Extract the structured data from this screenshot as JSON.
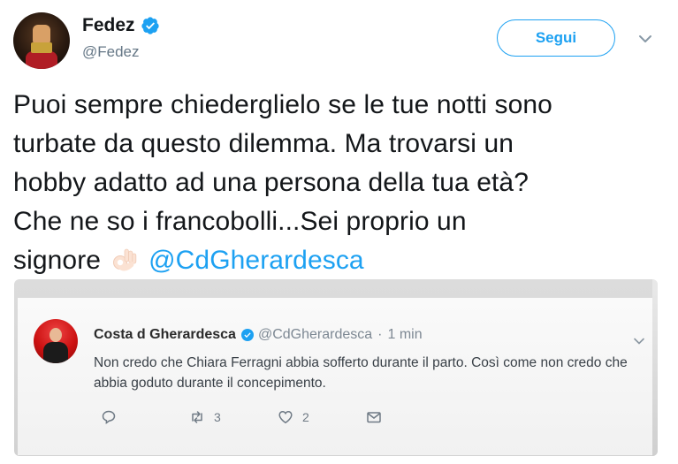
{
  "author": {
    "display_name": "Fedez",
    "handle": "@Fedez",
    "verified": true,
    "avatar_icon": "avatar-fist-photo"
  },
  "follow_button": {
    "label": "Segui"
  },
  "tweet": {
    "lines": [
      "Puoi sempre chiederglielo se le tue notti sono",
      "turbate da questo dilemma. Ma trovarsi un",
      "hobby adatto ad una persona della tua età?",
      "Che ne so i francobolli...Sei proprio un"
    ],
    "last_line_prefix": "signore",
    "emoji": "ok-hand-icon",
    "mention": "@CdGherardesca"
  },
  "embedded_tweet": {
    "display_name": "Costa d Gherardesca",
    "verified": true,
    "handle": "@CdGherardesca",
    "separator": "·",
    "time": "1 min",
    "text": "Non credo che Chiara Ferragni abbia sofferto durante il parto. Così come non credo che abbia goduto durante il concepimento.",
    "actions": {
      "retweets": "3",
      "likes": "2"
    }
  },
  "colors": {
    "accent": "#1da1f2",
    "text": "#14171a",
    "secondary": "#657786"
  }
}
